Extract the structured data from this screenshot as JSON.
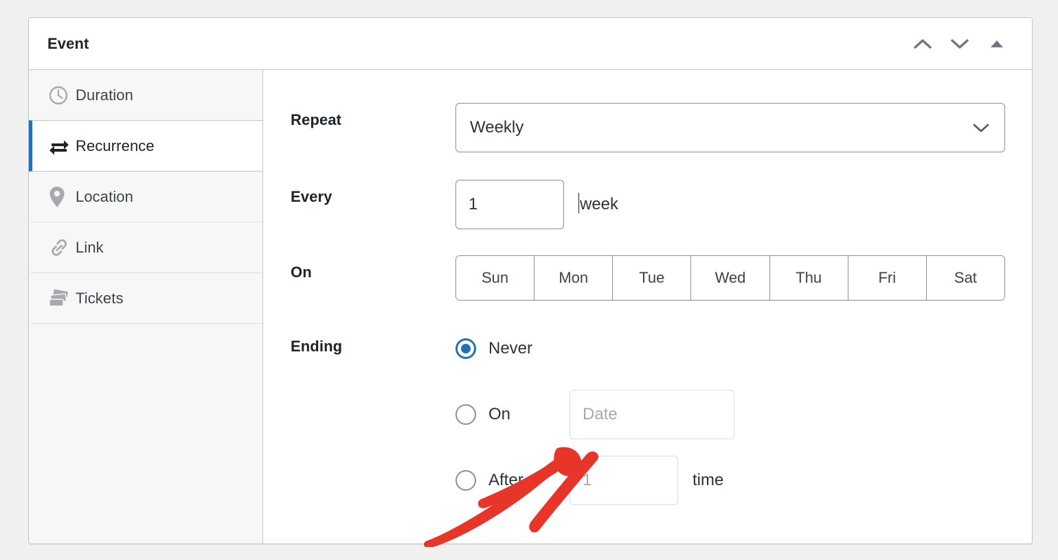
{
  "page": {
    "background_color": "#f0f0f1",
    "panel_background": "#ffffff",
    "accent_color": "#2271b1",
    "annotation_color": "#e8352a"
  },
  "header": {
    "title": "Event",
    "actions": [
      {
        "name": "move-up-button",
        "icon": "chevron-up-icon"
      },
      {
        "name": "move-down-button",
        "icon": "chevron-down-icon"
      },
      {
        "name": "collapse-button",
        "icon": "triangle-up-icon"
      }
    ]
  },
  "sidebar": {
    "items": [
      {
        "label": "Duration",
        "icon": "clock-icon",
        "active": false
      },
      {
        "label": "Recurrence",
        "icon": "repeat-icon",
        "active": true
      },
      {
        "label": "Location",
        "icon": "map-pin-icon",
        "active": false
      },
      {
        "label": "Link",
        "icon": "link-icon",
        "active": false
      },
      {
        "label": "Tickets",
        "icon": "tickets-icon",
        "active": false
      }
    ]
  },
  "form": {
    "repeat": {
      "label": "Repeat",
      "selected": "Weekly",
      "options": [
        "Weekly"
      ]
    },
    "every": {
      "label": "Every",
      "value": "1",
      "unit": "week"
    },
    "on": {
      "label": "On",
      "days": [
        "Sun",
        "Mon",
        "Tue",
        "Wed",
        "Thu",
        "Fri",
        "Sat"
      ]
    },
    "ending": {
      "label": "Ending",
      "options": [
        {
          "label": "Never",
          "selected": true
        },
        {
          "label": "On",
          "selected": false
        },
        {
          "label": "After",
          "selected": false
        }
      ],
      "date_placeholder": "Date",
      "count_placeholder": "1",
      "count_unit": "time"
    }
  },
  "annotation": {
    "name": "red-arrow-pointing-to-ending",
    "color": "#e8352a"
  }
}
